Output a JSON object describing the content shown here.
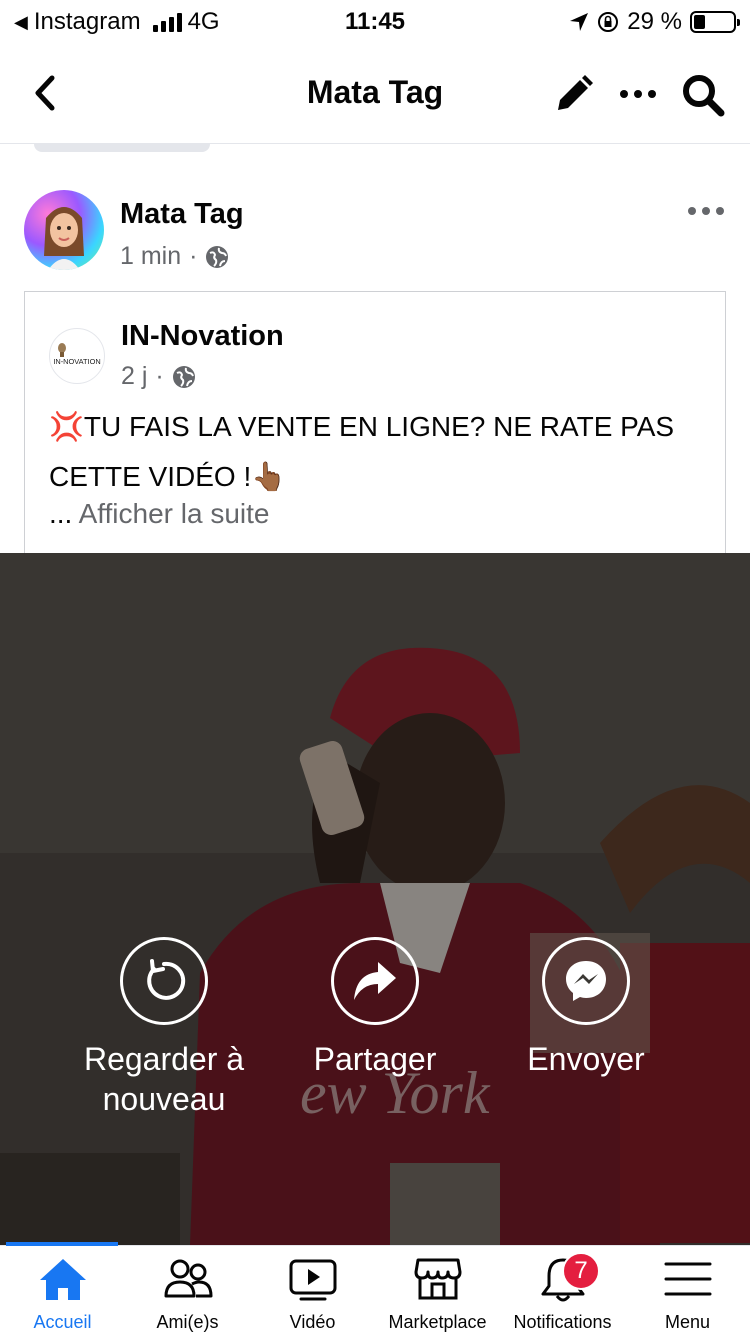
{
  "status_bar": {
    "back_app": "Instagram",
    "network": "4G",
    "time": "11:45",
    "battery_text": "29 %",
    "battery_level": 0.29
  },
  "header": {
    "title": "Mata Tag",
    "icons": [
      "back-chevron-icon",
      "pencil-icon",
      "more-icon",
      "search-icon"
    ]
  },
  "post": {
    "author": "Mata Tag",
    "time": "1 min",
    "separator": "·",
    "audience_icon": "globe-icon"
  },
  "shared_post": {
    "page_name": "IN-Novation",
    "logo_text": "IN-NOVATION",
    "time": "2 j",
    "separator": "·",
    "text_line1": "💢TU FAIS LA VENTE EN LIGNE? NE RATE PAS",
    "text_line2": "CETTE VIDÉO !👆🏾",
    "ellipsis": "...",
    "see_more": "Afficher la suite"
  },
  "video": {
    "sweatshirt_text": "ew York",
    "actions": [
      {
        "label_line1": "Regarder à",
        "label_line2": "nouveau",
        "icon": "replay-icon"
      },
      {
        "label_line1": "Partager",
        "label_line2": "",
        "icon": "share-arrow-icon"
      },
      {
        "label_line1": "Envoyer",
        "label_line2": "",
        "icon": "messenger-icon"
      }
    ]
  },
  "tabbar": {
    "accent_color": "#1877f2",
    "tabs": [
      {
        "label": "Accueil",
        "icon": "home-icon",
        "active": true
      },
      {
        "label": "Ami(e)s",
        "icon": "friends-icon"
      },
      {
        "label": "Vidéo",
        "icon": "video-icon"
      },
      {
        "label": "Marketplace",
        "icon": "marketplace-icon"
      },
      {
        "label": "Notifications",
        "icon": "bell-icon",
        "badge": "7"
      },
      {
        "label": "Menu",
        "icon": "hamburger-icon"
      }
    ]
  }
}
